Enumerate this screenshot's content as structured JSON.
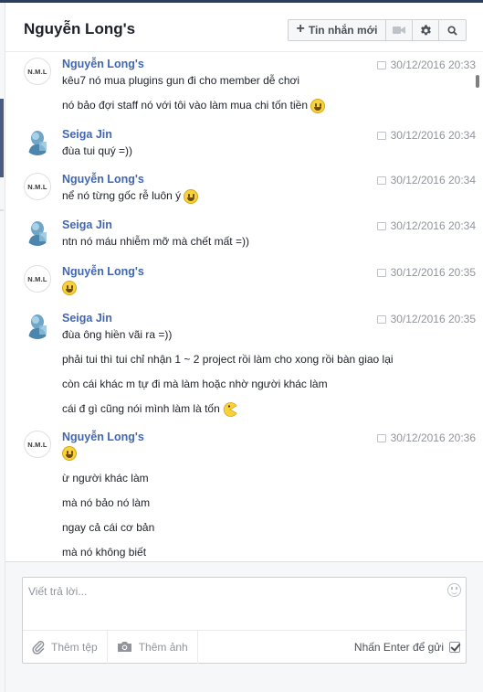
{
  "header": {
    "title": "Nguyễn Long's",
    "new_message_label": "Tin nhắn mới",
    "icons": [
      "plus-icon",
      "video-call-icon",
      "gear-icon",
      "search-icon"
    ]
  },
  "messages": [
    {
      "author": "Nguyễn Long's",
      "avatar": "N.M.L",
      "time": "30/12/2016 20:33",
      "lines": [
        "kêu7 nó mua plugins gun đi cho member dễ chơi",
        "nó bảo đợi staff nó với tôi vào làm mua chi tốn tiền"
      ]
    },
    {
      "author": "Seiga Jin",
      "avatar": "",
      "time": "30/12/2016 20:34",
      "lines": [
        "đùa tui quý =))"
      ]
    },
    {
      "author": "Nguyễn Long's",
      "avatar": "N.M.L",
      "time": "30/12/2016 20:34",
      "lines": [
        "nể nó từng gốc rễ luôn ý"
      ]
    },
    {
      "author": "Seiga Jin",
      "avatar": "",
      "time": "30/12/2016 20:34",
      "lines": [
        "ntn nó máu nhiễm mỡ mà chết mất =))"
      ]
    },
    {
      "author": "Nguyễn Long's",
      "avatar": "N.M.L",
      "time": "30/12/2016 20:35",
      "lines": []
    },
    {
      "author": "Seiga Jin",
      "avatar": "",
      "time": "30/12/2016 20:35",
      "lines": [
        "đùa ông hiền vãi ra =))",
        "phải tui thì tui chỉ nhận 1 ~ 2 project rồi làm cho xong rồi bàn giao lại",
        "còn cái khác m tự đi mà làm hoặc nhờ người khác làm",
        "cái đ gì cũng nói mình làm là tốn"
      ]
    },
    {
      "author": "Nguyễn Long's",
      "avatar": "N.M.L",
      "time": "30/12/2016 20:36",
      "lines": [
        "ừ người khác làm",
        "mà nó bảo nó làm",
        "ngay cả cái cơ bản",
        "mà nó không biết"
      ]
    }
  ],
  "composer": {
    "placeholder": "Viết trả lời...",
    "attach_file_label": "Thêm tệp",
    "attach_photo_label": "Thêm ảnh",
    "enter_to_send_label": "Nhấn Enter để gửi",
    "enter_to_send_checked": true
  },
  "colors": {
    "author": "#4267b2",
    "timestamp": "#90949c",
    "header_border": "#2d3e5d"
  }
}
